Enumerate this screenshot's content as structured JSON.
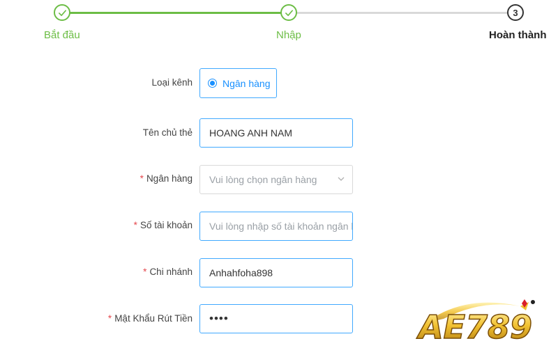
{
  "stepper": {
    "steps": [
      {
        "label": "Bắt đầu",
        "state": "done"
      },
      {
        "label": "Nhập",
        "state": "done"
      },
      {
        "label": "Hoàn thành",
        "state": "current",
        "number": "3"
      }
    ]
  },
  "form": {
    "channel": {
      "label": "Loại kênh",
      "option": "Ngân hàng",
      "selected": true
    },
    "holder_name": {
      "label": "Tên chủ thẻ",
      "value": "HOANG ANH NAM"
    },
    "bank": {
      "label": "Ngân hàng",
      "required_mark": "*",
      "placeholder": "Vui lòng chọn ngân hàng"
    },
    "account_number": {
      "label": "Số tài khoản",
      "required_mark": "*",
      "placeholder": "Vui lòng nhập số tài khoản ngân hà"
    },
    "branch": {
      "label": "Chi nhánh",
      "required_mark": "*",
      "value": "Anhahfoha898"
    },
    "withdraw_password": {
      "label": "Mật Khẩu Rút Tiền",
      "required_mark": "*",
      "value": "••••"
    }
  },
  "logo": {
    "text": "AE789"
  },
  "colors": {
    "step_done": "#6cbd45",
    "accent": "#1890ff",
    "input_border": "#40a9ff",
    "required": "#e5484d",
    "logo_gold": "#f2c232"
  },
  "icons": {
    "step_done": "check-icon",
    "bank_select": "chevron-down-icon"
  }
}
